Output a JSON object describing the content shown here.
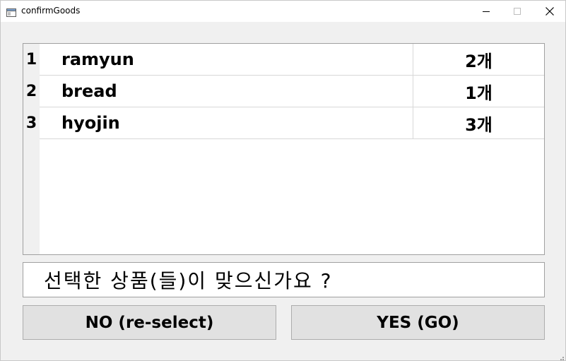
{
  "window": {
    "title": "confirmGoods"
  },
  "table": {
    "rows": [
      {
        "index": "1",
        "name": "ramyun",
        "quantity": "2개"
      },
      {
        "index": "2",
        "name": "bread",
        "quantity": "1개"
      },
      {
        "index": "3",
        "name": "hyojin",
        "quantity": "3개"
      }
    ]
  },
  "prompt": {
    "text": "선택한 상품(들)이 맞으신가요 ?"
  },
  "buttons": {
    "no_label": "NO (re-select)",
    "yes_label": "YES (GO)"
  },
  "icons": {
    "app": "window-app-icon",
    "minimize": "minimize-icon",
    "maximize": "maximize-icon",
    "close": "close-icon",
    "grip": "resize-grip-icon"
  }
}
